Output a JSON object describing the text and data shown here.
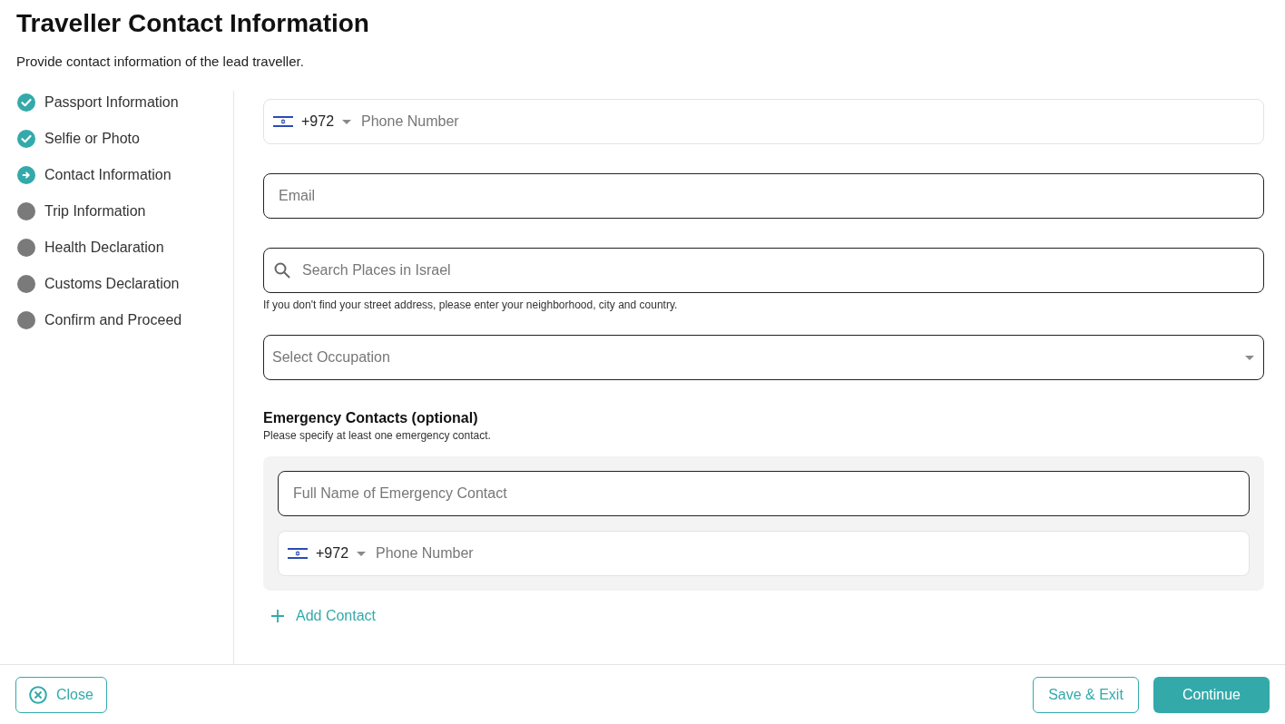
{
  "header": {
    "title": "Traveller Contact Information",
    "subtitle": "Provide contact information of the lead traveller."
  },
  "steps": [
    {
      "label": "Passport Information",
      "completed": true,
      "current": false
    },
    {
      "label": "Selfie or Photo",
      "completed": true,
      "current": false
    },
    {
      "label": "Contact Information",
      "completed": false,
      "current": true
    },
    {
      "label": "Trip Information",
      "completed": false,
      "current": false
    },
    {
      "label": "Health Declaration",
      "completed": false,
      "current": false
    },
    {
      "label": "Customs Declaration",
      "completed": false,
      "current": false
    },
    {
      "label": "Confirm and Proceed",
      "completed": false,
      "current": false
    }
  ],
  "form": {
    "phone": {
      "country_code": "+972",
      "placeholder": "Phone Number"
    },
    "email": {
      "placeholder": "Email"
    },
    "address": {
      "placeholder": "Search Places in Israel",
      "hint": "If you don't find your street address, please enter your neighborhood, city and country."
    },
    "occupation": {
      "placeholder": "Select Occupation"
    }
  },
  "emergency": {
    "title": "Emergency Contacts (optional)",
    "subtitle": "Please specify at least one emergency contact.",
    "contacts": [
      {
        "name_placeholder": "Full Name of Emergency Contact",
        "country_code": "+972",
        "phone_placeholder": "Phone Number"
      }
    ],
    "add_label": "Add Contact"
  },
  "footer": {
    "close": "Close",
    "save": "Save & Exit",
    "continue": "Continue"
  }
}
